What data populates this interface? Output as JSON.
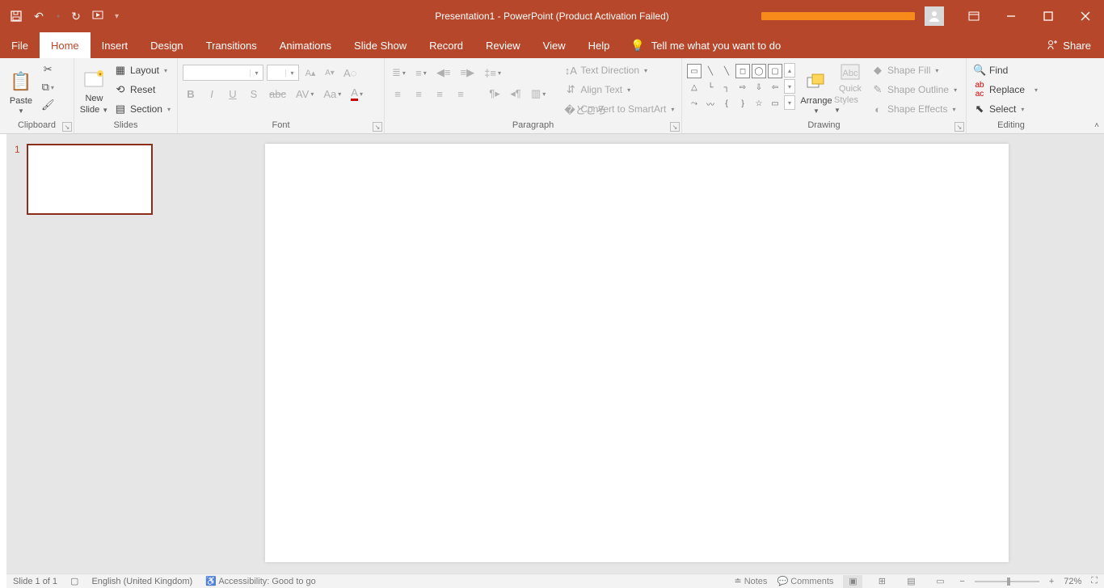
{
  "title_bar": {
    "doc_title": "Presentation1  -  PowerPoint (Product Activation Failed)"
  },
  "tabs": {
    "file": "File",
    "home": "Home",
    "insert": "Insert",
    "design": "Design",
    "transitions": "Transitions",
    "animations": "Animations",
    "slide_show": "Slide Show",
    "record": "Record",
    "review": "Review",
    "view": "View",
    "help": "Help",
    "tell_me": "Tell me what you want to do",
    "share": "Share"
  },
  "ribbon": {
    "clipboard": {
      "label": "Clipboard",
      "paste": "Paste"
    },
    "slides": {
      "label": "Slides",
      "new_slide_l1": "New",
      "new_slide_l2": "Slide",
      "layout": "Layout",
      "reset": "Reset",
      "section": "Section"
    },
    "font": {
      "label": "Font",
      "font_name": "",
      "font_size": ""
    },
    "paragraph": {
      "label": "Paragraph",
      "text_direction": "Text Direction",
      "align_text": "Align Text",
      "convert_smartart": "Convert to SmartArt"
    },
    "drawing": {
      "label": "Drawing",
      "arrange": "Arrange",
      "quick_l1": "Quick",
      "quick_l2": "Styles",
      "shape_fill": "Shape Fill",
      "shape_outline": "Shape Outline",
      "shape_effects": "Shape Effects"
    },
    "editing": {
      "label": "Editing",
      "find": "Find",
      "replace": "Replace",
      "select": "Select"
    }
  },
  "thumb": {
    "num": "1"
  },
  "status": {
    "slide": "Slide 1 of 1",
    "lang": "English (United Kingdom)",
    "access": "Accessibility: Good to go",
    "notes": "Notes",
    "comments": "Comments",
    "zoom": "72%"
  }
}
